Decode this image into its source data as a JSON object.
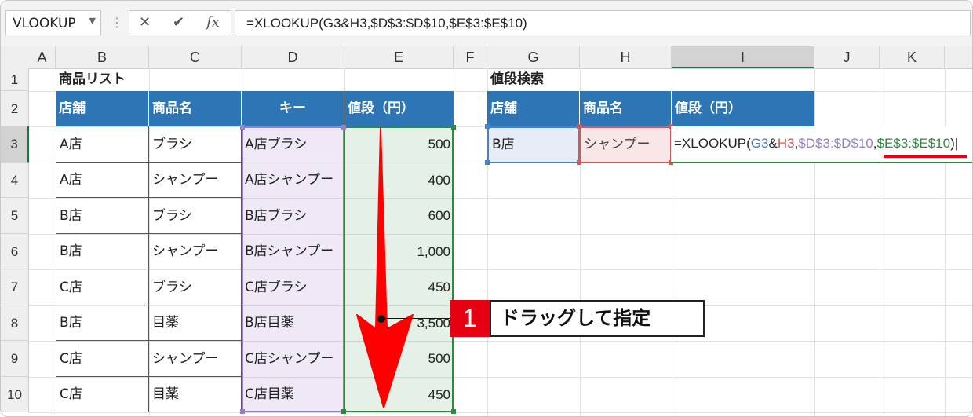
{
  "formula_bar": {
    "name_box": "VLOOKUP",
    "cancel_symbol": "✕",
    "enter_symbol": "✔",
    "fx_symbol": "fx",
    "formula": "=XLOOKUP(G3&H3,$D$3:$D$10,$E$3:$E$10)"
  },
  "columns": [
    "A",
    "B",
    "C",
    "D",
    "E",
    "F",
    "G",
    "H",
    "I",
    "J",
    "K"
  ],
  "rows": [
    "1",
    "2",
    "3",
    "4",
    "5",
    "6",
    "7",
    "8",
    "9",
    "10"
  ],
  "product_list": {
    "title": "商品リスト",
    "headers": [
      "店舗",
      "商品名",
      "キー",
      "値段（円）"
    ],
    "rows": [
      [
        "A店",
        "ブラシ",
        "A店ブラシ",
        "500"
      ],
      [
        "A店",
        "シャンプー",
        "A店シャンプー",
        "400"
      ],
      [
        "B店",
        "ブラシ",
        "B店ブラシ",
        "600"
      ],
      [
        "B店",
        "シャンプー",
        "B店シャンプー",
        "1,000"
      ],
      [
        "C店",
        "ブラシ",
        "C店ブラシ",
        "450"
      ],
      [
        "B店",
        "目薬",
        "B店目薬",
        "3,500"
      ],
      [
        "C店",
        "シャンプー",
        "C店シャンプー",
        "500"
      ],
      [
        "C店",
        "目薬",
        "C店目薬",
        "450"
      ]
    ]
  },
  "price_search": {
    "title": "値段検索",
    "headers": [
      "店舗",
      "商品名",
      "値段（円）"
    ],
    "store": "B店",
    "product": "シャンプー",
    "formula_parts": {
      "p1": "=XLOOKUP(",
      "p2": "G3",
      "p3": "&",
      "p4": "H3",
      "p5": ",",
      "p6": "$D$3:$D$10",
      "p7": ",",
      "p8": "$E$3:$E$10",
      "p9": ")"
    }
  },
  "callout": {
    "number": "1",
    "text": "ドラッグして指定"
  },
  "colors": {
    "header_blue": "#2e75b6",
    "ref_blue": "#4a7fc9",
    "ref_red": "#d05a5a",
    "ref_purple": "#9b7fc6",
    "ref_green": "#2e8b3e",
    "accent_red": "#e60012"
  }
}
